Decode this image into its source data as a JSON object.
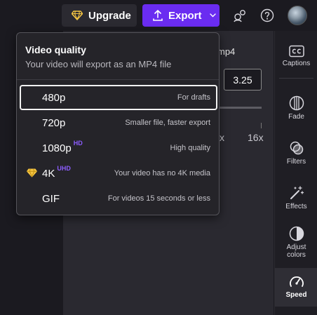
{
  "topbar": {
    "upgrade_label": "Upgrade",
    "export_label": "Export",
    "icons": [
      "diamond-icon",
      "upload-icon",
      "chevron-down-icon",
      "share-icon",
      "help-icon",
      "avatar"
    ]
  },
  "editor": {
    "filename_fragment": "mp4",
    "speed_value": "3.25",
    "scale_labels": [
      "x",
      "16x"
    ]
  },
  "right_panel": {
    "items": [
      {
        "label": "Captions",
        "icon": "captions-icon"
      },
      {
        "label": "Fade",
        "icon": "fade-icon"
      },
      {
        "label": "Filters",
        "icon": "filters-icon"
      },
      {
        "label": "Effects",
        "icon": "effects-icon"
      },
      {
        "label": "Adjust colors",
        "icon": "adjust-colors-icon"
      },
      {
        "label": "Speed",
        "icon": "speed-icon",
        "active": true
      }
    ]
  },
  "export_menu": {
    "title": "Video quality",
    "subtitle": "Your video will export as an MP4 file",
    "options": [
      {
        "label": "480p",
        "badge": "",
        "desc": "For drafts",
        "selected": true
      },
      {
        "label": "720p",
        "badge": "",
        "desc": "Smaller file, faster export"
      },
      {
        "label": "1080p",
        "badge": "HD",
        "desc": "High quality"
      },
      {
        "label": "4K",
        "badge": "UHD",
        "desc": "Your video has no 4K media",
        "premium": true
      },
      {
        "label": "GIF",
        "badge": "",
        "desc": "For videos 15 seconds or less"
      }
    ]
  },
  "colors": {
    "accent": "#6a2cf1",
    "badge": "#8c5cff",
    "gem": "#f5c542"
  }
}
